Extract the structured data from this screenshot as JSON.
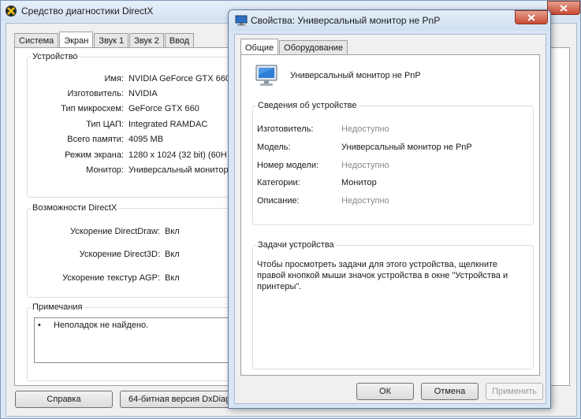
{
  "dx_window": {
    "title": "Средство диагностики DirectX",
    "tabs": [
      "Система",
      "Экран",
      "Звук 1",
      "Звук 2",
      "Ввод"
    ],
    "device_group": {
      "legend": "Устройство",
      "rows": [
        {
          "label": "Имя:",
          "value": "NVIDIA GeForce GTX 660"
        },
        {
          "label": "Изготовитель:",
          "value": "NVIDIA"
        },
        {
          "label": "Тип микросхем:",
          "value": "GeForce GTX 660"
        },
        {
          "label": "Тип ЦАП:",
          "value": "Integrated RAMDAC"
        },
        {
          "label": "Всего памяти:",
          "value": "4095 MB"
        },
        {
          "label": "Режим экрана:",
          "value": "1280 x 1024 (32 bit) (60H"
        },
        {
          "label": "Монитор:",
          "value": "Универсальный монитор"
        }
      ]
    },
    "features_group": {
      "legend": "Возможности DirectX",
      "rows": [
        {
          "label": "Ускорение DirectDraw:",
          "value": "Вкл"
        },
        {
          "label": "Ускорение Direct3D:",
          "value": "Вкл"
        },
        {
          "label": "Ускорение текстур AGP:",
          "value": "Вкл"
        }
      ]
    },
    "notes_group": {
      "legend": "Примечания",
      "items": [
        "Неполадок не найдено."
      ]
    },
    "buttons": {
      "help": "Справка",
      "bit64": "64-битная версия DxDiag"
    },
    "colors": {
      "titlebar": "#d4e2f3",
      "panel": "#f0f0f0"
    }
  },
  "props_window": {
    "title": "Свойства: Универсальный монитор не PnP",
    "tabs": [
      "Общие",
      "Оборудование"
    ],
    "device_name": "Универсальный монитор не PnP",
    "info_group": {
      "legend": "Сведения об устройстве",
      "rows": [
        {
          "label": "Изготовитель:",
          "value": "Недоступно"
        },
        {
          "label": "Модель:",
          "value": "Универсальный монитор не PnP"
        },
        {
          "label": "Номер модели:",
          "value": "Недоступно"
        },
        {
          "label": "Категории:",
          "value": "Монитор"
        },
        {
          "label": "Описание:",
          "value": "Недоступно"
        }
      ]
    },
    "tasks_group": {
      "legend": "Задачи устройства",
      "text": "Чтобы просмотреть задачи для этого устройства, щелкните правой кнопкой мыши значок устройства в окне \"Устройства и принтеры\"."
    },
    "buttons": {
      "ok": "ОК",
      "cancel": "Отмена",
      "apply": "Применить"
    }
  }
}
